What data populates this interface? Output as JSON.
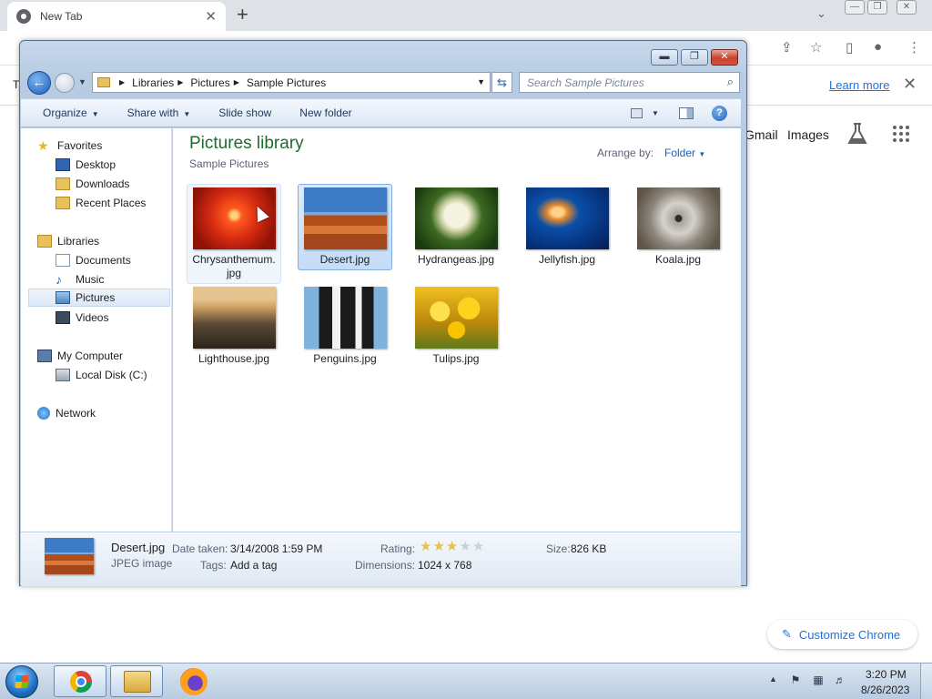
{
  "chrome": {
    "tab_title": "New Tab",
    "tab_close": "✕",
    "new_tab": "+",
    "infobar_text": "T",
    "learn_more": "Learn more",
    "infobar_close": "✕",
    "gmail": "Gmail",
    "images": "Images",
    "customize": "Customize Chrome",
    "icons": [
      "chrome-logo-icon",
      "share-icon",
      "bookmark-star-icon",
      "side-panel-icon",
      "profile-icon",
      "more-menu-icon",
      "labs-flask-icon",
      "apps-grid-icon",
      "pencil-icon"
    ]
  },
  "explorer": {
    "breadcrumb": [
      "Libraries",
      "Pictures",
      "Sample Pictures"
    ],
    "search_placeholder": "Search Sample Pictures",
    "toolbar": {
      "organize": "Organize",
      "share_with": "Share with",
      "slide_show": "Slide show",
      "new_folder": "New folder"
    },
    "nav": {
      "favorites": "Favorites",
      "desktop": "Desktop",
      "downloads": "Downloads",
      "recent_places": "Recent Places",
      "libraries": "Libraries",
      "documents": "Documents",
      "music": "Music",
      "pictures": "Pictures",
      "videos": "Videos",
      "my_computer": "My Computer",
      "local_disk": "Local Disk (C:)",
      "network": "Network"
    },
    "content": {
      "title": "Pictures library",
      "subtitle": "Sample Pictures",
      "arrange_by_label": "Arrange by:",
      "arrange_by_value": "Folder"
    },
    "files": [
      {
        "name": "Chrysanthemum.jpg",
        "line1": "Chrysanthemum.",
        "line2": "jpg"
      },
      {
        "name": "Desert.jpg"
      },
      {
        "name": "Hydrangeas.jpg"
      },
      {
        "name": "Jellyfish.jpg"
      },
      {
        "name": "Koala.jpg"
      },
      {
        "name": "Lighthouse.jpg"
      },
      {
        "name": "Penguins.jpg"
      },
      {
        "name": "Tulips.jpg"
      }
    ],
    "details": {
      "name": "Desert.jpg",
      "type": "JPEG image",
      "date_label": "Date taken:",
      "date_value": "3/14/2008 1:59 PM",
      "tags_label": "Tags:",
      "tags_value": "Add a tag",
      "rating_label": "Rating:",
      "rating": 3,
      "rating_max": 5,
      "dimensions_label": "Dimensions:",
      "dimensions_value": "1024 x 768",
      "size_label": "Size:",
      "size_value": "826 KB"
    }
  },
  "taskbar": {
    "time": "3:20 PM",
    "date": "8/26/2023"
  }
}
